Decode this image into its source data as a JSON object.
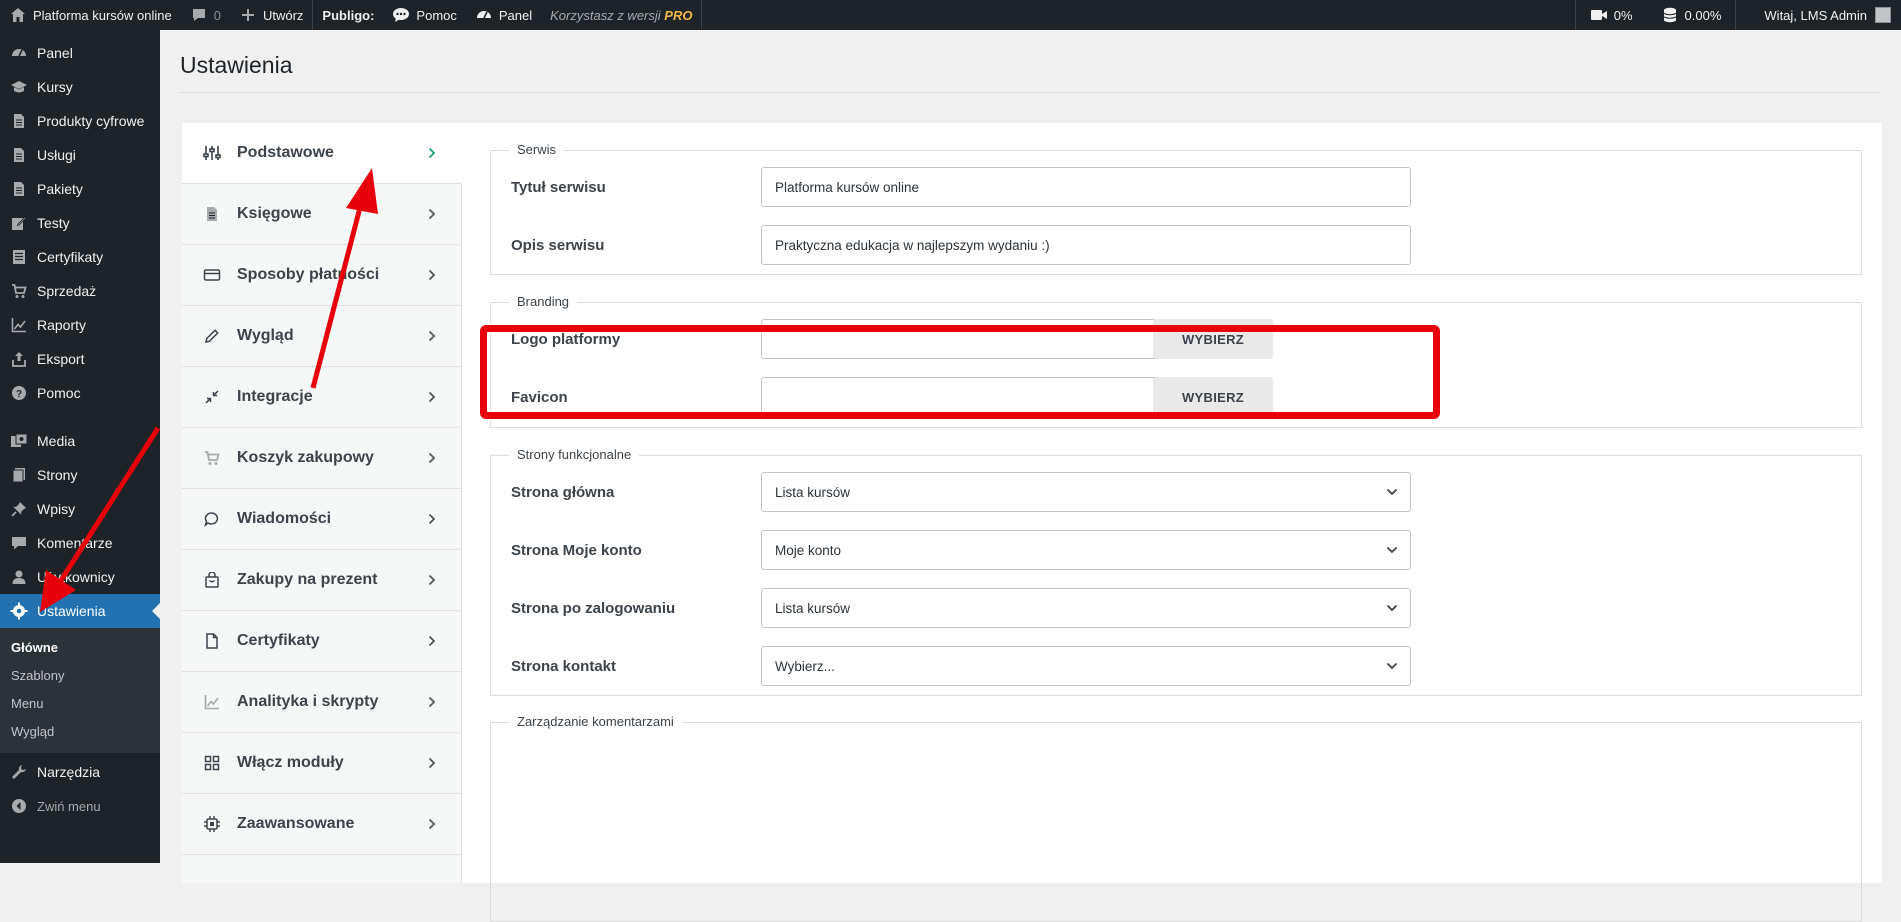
{
  "adminbar": {
    "site_name": "Platforma kursów online",
    "comments_count": "0",
    "new_label": "Utwórz",
    "brand": "Publigo:",
    "help": "Pomoc",
    "panel": "Panel",
    "pro_prefix": "Korzystasz z wersji",
    "pro_badge": "PRO",
    "video_pct": "0%",
    "db_pct": "0.00%",
    "greeting": "Witaj, LMS Admin"
  },
  "sidebar": {
    "items_top": [
      {
        "label": "Panel",
        "icon": "dashboard-icon"
      },
      {
        "label": "Kursy",
        "icon": "graduation-cap-icon"
      },
      {
        "label": "Produkty cyfrowe",
        "icon": "document-icon"
      },
      {
        "label": "Usługi",
        "icon": "document-icon"
      },
      {
        "label": "Pakiety",
        "icon": "document-icon"
      },
      {
        "label": "Testy",
        "icon": "edit-icon"
      },
      {
        "label": "Certyfikaty",
        "icon": "list-icon"
      },
      {
        "label": "Sprzedaż",
        "icon": "cart-icon"
      },
      {
        "label": "Raporty",
        "icon": "chart-icon"
      },
      {
        "label": "Eksport",
        "icon": "export-icon"
      },
      {
        "label": "Pomoc",
        "icon": "help-icon"
      }
    ],
    "items_mid": [
      {
        "label": "Media",
        "icon": "media-icon"
      },
      {
        "label": "Strony",
        "icon": "pages-icon"
      },
      {
        "label": "Wpisy",
        "icon": "pin-icon"
      },
      {
        "label": "Komentarze",
        "icon": "comment-icon"
      },
      {
        "label": "Użytkownicy",
        "icon": "user-icon"
      }
    ],
    "active": "Ustawienia",
    "submenu": [
      "Główne",
      "Szablony",
      "Menu",
      "Wygląd"
    ],
    "tools": "Narzędzia",
    "collapse": "Zwiń menu"
  },
  "page": {
    "title": "Ustawienia"
  },
  "settings_nav": [
    {
      "label": "Podstawowe",
      "icon": "sliders-icon"
    },
    {
      "label": "Księgowe",
      "icon": "document-icon"
    },
    {
      "label": "Sposoby płatności",
      "icon": "card-icon"
    },
    {
      "label": "Wygląd",
      "icon": "pencil-icon"
    },
    {
      "label": "Integracje",
      "icon": "plug-icon"
    },
    {
      "label": "Koszyk zakupowy",
      "icon": "cart-icon"
    },
    {
      "label": "Wiadomości",
      "icon": "chat-icon"
    },
    {
      "label": "Zakupy na prezent",
      "icon": "gift-icon"
    },
    {
      "label": "Certyfikaty",
      "icon": "file-icon"
    },
    {
      "label": "Analityka i skrypty",
      "icon": "chart-icon"
    },
    {
      "label": "Włącz moduły",
      "icon": "grid-icon"
    },
    {
      "label": "Zaawansowane",
      "icon": "chip-icon"
    }
  ],
  "serwis": {
    "legend": "Serwis",
    "title_label": "Tytuł serwisu",
    "title_value": "Platforma kursów online",
    "desc_label": "Opis serwisu",
    "desc_value": "Praktyczna edukacja w najlepszym wydaniu :)"
  },
  "branding": {
    "legend": "Branding",
    "logo_label": "Logo platformy",
    "logo_value": "",
    "favicon_label": "Favicon",
    "favicon_value": "",
    "pick_label": "WYBIERZ"
  },
  "strony": {
    "legend": "Strony funkcjonalne",
    "rows": [
      {
        "label": "Strona główna",
        "value": "Lista kursów"
      },
      {
        "label": "Strona Moje konto",
        "value": "Moje konto"
      },
      {
        "label": "Strona po zalogowaniu",
        "value": "Lista kursów"
      },
      {
        "label": "Strona kontakt",
        "value": "Wybierz..."
      }
    ]
  },
  "komentarze": {
    "legend": "Zarządzanie komentarzami"
  },
  "colors": {
    "admin_dark": "#1d2327",
    "accent_blue": "#2271b1",
    "annotation_red": "#e8000b",
    "active_chevron": "#22a06b"
  }
}
